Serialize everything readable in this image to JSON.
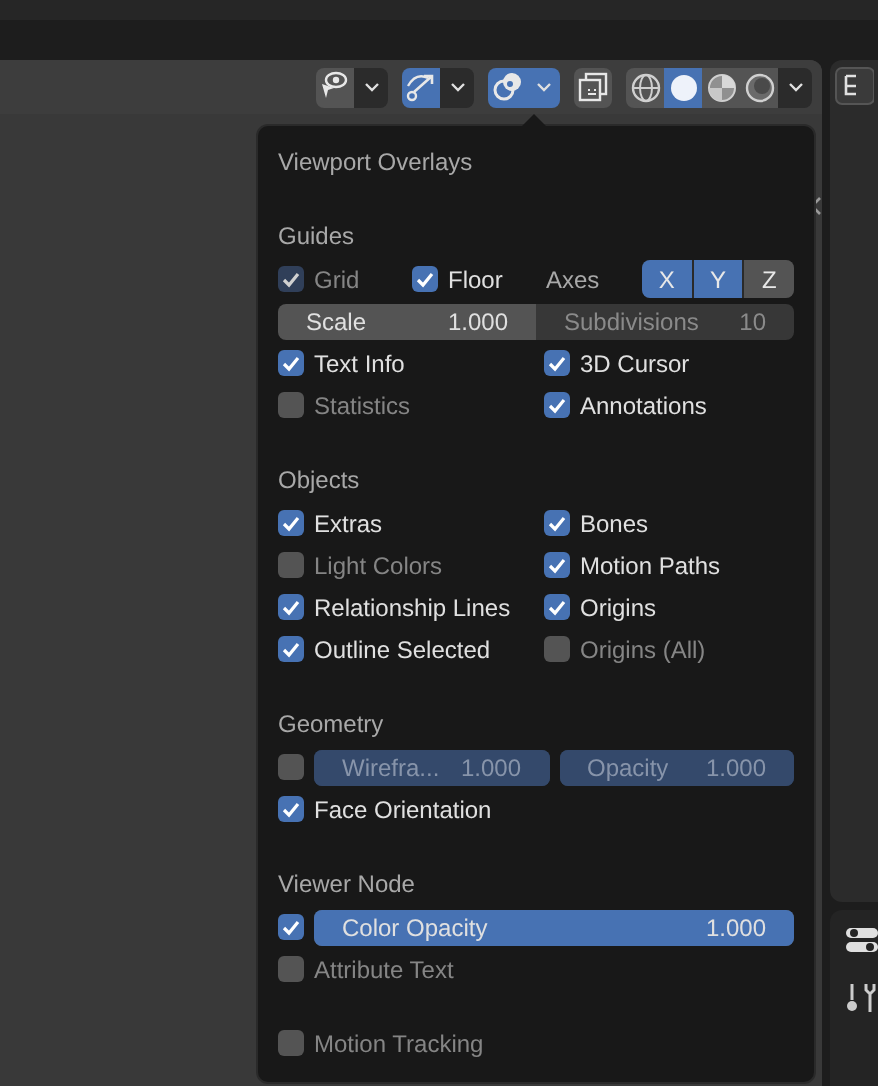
{
  "header": {
    "groups": [
      {
        "items": [
          {
            "kind": "icon",
            "selected": false
          },
          {
            "kind": "menu",
            "selected": false
          }
        ]
      },
      {
        "items": [
          {
            "kind": "icon",
            "selected": true
          },
          {
            "kind": "menu",
            "selected": false
          }
        ]
      },
      {
        "items": [
          {
            "kind": "icon",
            "selected": true
          },
          {
            "kind": "menu",
            "selected": true
          }
        ]
      },
      {
        "items": [
          {
            "kind": "icon",
            "selected": false
          }
        ]
      },
      {
        "items": [
          {
            "kind": "icon",
            "selected": false
          },
          {
            "kind": "icon",
            "selected": true
          },
          {
            "kind": "icon",
            "selected": false
          },
          {
            "kind": "icon",
            "selected": false
          },
          {
            "kind": "menu",
            "selected": false
          }
        ]
      }
    ]
  },
  "popover": {
    "title": "Viewport Overlays",
    "sections": [
      {
        "heading": "Guides",
        "rows": [
          {
            "kind": "axes",
            "cells": [
              {
                "kind": "check",
                "label": "Grid",
                "checked": true,
                "disabled": true
              },
              {
                "kind": "check",
                "label": "Floor",
                "checked": true
              },
              {
                "kind": "label",
                "text": "Axes"
              },
              {
                "kind": "toggles",
                "options": [
                  {
                    "label": "X",
                    "selected": true
                  },
                  {
                    "label": "Y",
                    "selected": true
                  },
                  {
                    "label": "Z",
                    "selected": false
                  }
                ]
              }
            ]
          },
          {
            "kind": "joined",
            "cells": [
              {
                "kind": "field",
                "label": "Scale",
                "value": "1.000"
              },
              {
                "kind": "field",
                "label": "Subdivisions",
                "value": "10",
                "disabled": true
              }
            ]
          },
          {
            "kind": "pair",
            "cells": [
              {
                "kind": "check",
                "label": "Text Info",
                "checked": true
              },
              {
                "kind": "check",
                "label": "3D Cursor",
                "checked": true
              }
            ]
          },
          {
            "kind": "pair",
            "cells": [
              {
                "kind": "check",
                "label": "Statistics",
                "checked": false
              },
              {
                "kind": "check",
                "label": "Annotations",
                "checked": true
              }
            ]
          }
        ]
      },
      {
        "heading": "Objects",
        "rows": [
          {
            "kind": "pair",
            "cells": [
              {
                "kind": "check",
                "label": "Extras",
                "checked": true
              },
              {
                "kind": "check",
                "label": "Bones",
                "checked": true
              }
            ]
          },
          {
            "kind": "pair",
            "cells": [
              {
                "kind": "check",
                "label": "Light Colors",
                "checked": false
              },
              {
                "kind": "check",
                "label": "Motion Paths",
                "checked": true
              }
            ]
          },
          {
            "kind": "pair",
            "cells": [
              {
                "kind": "check",
                "label": "Relationship Lines",
                "checked": true
              },
              {
                "kind": "check",
                "label": "Origins",
                "checked": true
              }
            ]
          },
          {
            "kind": "pair",
            "cells": [
              {
                "kind": "check",
                "label": "Outline Selected",
                "checked": true
              },
              {
                "kind": "check",
                "label": "Origins (All)",
                "checked": false
              }
            ]
          }
        ]
      },
      {
        "heading": "Geometry",
        "rows": [
          {
            "kind": "check-fields",
            "cells": [
              {
                "kind": "check",
                "checked": false
              },
              {
                "kind": "field",
                "label": "Wirefra...",
                "value": "1.000",
                "level": 1,
                "disabled": true
              },
              {
                "kind": "field",
                "label": "Opacity",
                "value": "1.000",
                "level": 1,
                "disabled": true
              }
            ]
          },
          {
            "kind": "single",
            "cells": [
              {
                "kind": "check",
                "label": "Face Orientation",
                "checked": true
              }
            ]
          }
        ]
      },
      {
        "heading": "Viewer Node",
        "rows": [
          {
            "kind": "check-fields",
            "cells": [
              {
                "kind": "check",
                "checked": true
              },
              {
                "kind": "field",
                "label": "Color Opacity",
                "value": "1.000",
                "level": 1
              }
            ]
          },
          {
            "kind": "single",
            "cells": [
              {
                "kind": "check",
                "label": "Attribute Text",
                "checked": false
              }
            ]
          }
        ]
      },
      {
        "rows": [
          {
            "kind": "single",
            "cells": [
              {
                "kind": "check",
                "label": "Motion Tracking",
                "checked": false
              }
            ]
          }
        ]
      }
    ]
  }
}
